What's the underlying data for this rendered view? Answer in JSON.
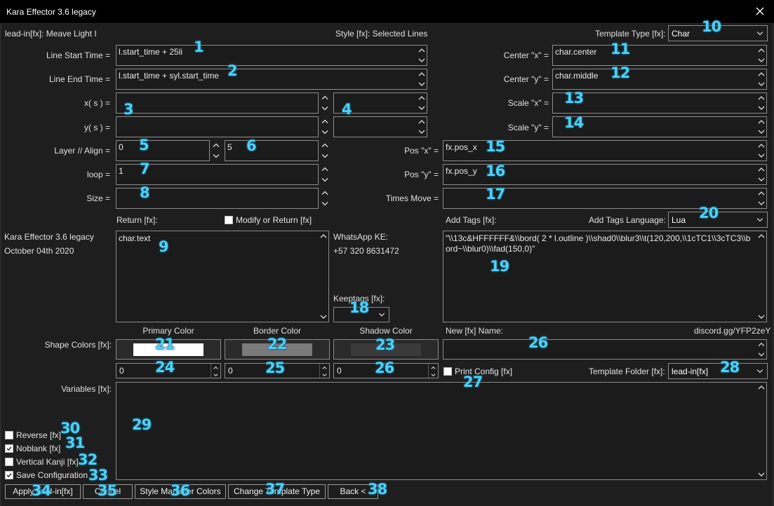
{
  "window": {
    "title": "Kara Effector 3.6 legacy"
  },
  "header": {
    "lead_in": "lead-in[fx]: Meave Light I",
    "style": "Style [fx]: Selected Lines",
    "template_type_label": "Template Type [fx]:",
    "template_type_value": "Char"
  },
  "fields": {
    "line_start_label": "Line Start Time =",
    "line_start_value": "l.start_time + 25li",
    "line_end_label": "Line End Time =",
    "line_end_value": "l.start_time + syl.start_time",
    "xs_label": "x( s ) =",
    "xs_value": "",
    "ys_label": "y( s ) =",
    "ys_value": "",
    "field4_value": "",
    "field4b_value": "",
    "layer_align_label": "Layer // Align =",
    "layer_value": "0",
    "align_value": "5",
    "loop_label": "loop =",
    "loop_value": "1",
    "size_label": "Size =",
    "size_value": "",
    "center_x_label": "Center \"x\" =",
    "center_x_value": "char.center",
    "center_y_label": "Center \"y\" =",
    "center_y_value": "char.middle",
    "scale_x_label": "Scale \"x\" =",
    "scale_x_value": "",
    "scale_y_label": "Scale \"y\" =",
    "scale_y_value": "",
    "pos_x_label": "Pos \"x\" =",
    "pos_x_value": "fx.pos_x",
    "pos_y_label": "Pos \"y\" =",
    "pos_y_value": "fx.pos_y",
    "times_move_label": "Times Move =",
    "times_move_value": ""
  },
  "return": {
    "label": "Return [fx]:",
    "modify_label": "Modify or Return [fx]",
    "value": "char.text"
  },
  "info": {
    "app_name": "Kara Effector 3.6 legacy",
    "date": "October 04th 2020",
    "whatsapp_label": "WhatsApp KE:",
    "whatsapp_number": "+57 320 8631472",
    "keeptags_label": "Keeptags [fx]:",
    "keeptags_value": "",
    "discord": "discord.gg/YFP2zeY"
  },
  "tags": {
    "label": "Add Tags [fx]:",
    "language_label": "Add Tags Language:",
    "language_value": "Lua",
    "value": "\"\\\\13c&HFFFFFF&\\\\bord( 2 * l.outline )\\\\shad0\\\\blur3\\\\t(120,200,\\\\1cTC1\\\\3cTC3\\\\bord~\\\\blur0)\\\\fad(150,0)\""
  },
  "colors": {
    "shape_label": "Shape Colors [fx]:",
    "primary_label": "Primary Color",
    "border_label": "Border Color",
    "shadow_label": "Shadow Color",
    "primary_hex": "#ffffff",
    "border_hex": "#7a7a7a",
    "shadow_hex": "#3a3a3a",
    "primary_alpha": "0",
    "border_alpha": "0",
    "shadow_alpha": "0"
  },
  "new_name": {
    "label": "New [fx] Name:",
    "value": ""
  },
  "print_config_label": "Print Config [fx]",
  "template_folder": {
    "label": "Template Folder [fx]:",
    "value": "lead-in[fx]"
  },
  "variables": {
    "label": "Variables [fx]:",
    "value": ""
  },
  "options": {
    "reverse": "Reverse [fx]",
    "noblank": "Noblank [fx]",
    "vertical_kanji": "Vertical Kanji [fx]",
    "save_config": "Save Configuration",
    "reverse_checked": false,
    "noblank_checked": true,
    "vertical_kanji_checked": false,
    "save_config_checked": true
  },
  "buttons": {
    "apply": "Apply lead-in[fx]",
    "cancel": "Cancel",
    "style_manager": "Style Manager Colors",
    "change_template": "Change Template Type",
    "back": "Back <"
  },
  "callouts": [
    "1",
    "2",
    "3",
    "4",
    "5",
    "6",
    "7",
    "8",
    "9",
    "10",
    "11",
    "12",
    "13",
    "14",
    "15",
    "16",
    "17",
    "18",
    "19",
    "20",
    "21",
    "22",
    "23",
    "24",
    "25",
    "26",
    "27",
    "28",
    "29",
    "30",
    "31",
    "32",
    "33",
    "34",
    "35",
    "36",
    "37",
    "38"
  ]
}
